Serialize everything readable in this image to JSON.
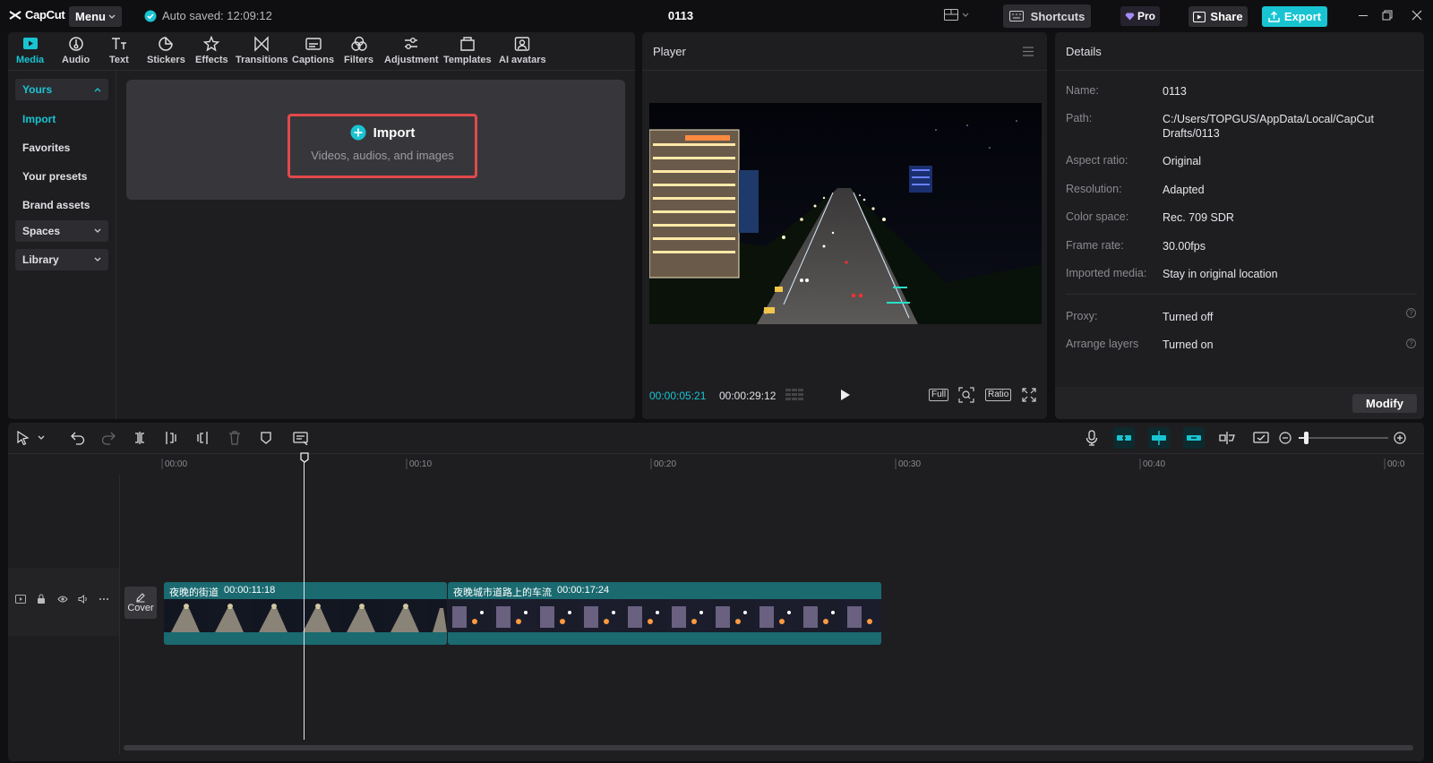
{
  "app": {
    "logo_text": "CapCut",
    "menu_label": "Menu",
    "autosave_text": "Auto saved: 12:09:12",
    "project_title": "0113",
    "shortcuts_label": "Shortcuts",
    "pro_label": "Pro",
    "share_label": "Share",
    "export_label": "Export"
  },
  "colors": {
    "accent": "#19c4d2",
    "highlight_border": "#e2494b",
    "clip_bg": "#1a6a70"
  },
  "tool_tabs": [
    {
      "label": "Media",
      "icon": "media-icon"
    },
    {
      "label": "Audio",
      "icon": "audio-icon"
    },
    {
      "label": "Text",
      "icon": "text-icon"
    },
    {
      "label": "Stickers",
      "icon": "stickers-icon"
    },
    {
      "label": "Effects",
      "icon": "effects-icon"
    },
    {
      "label": "Transitions",
      "icon": "transitions-icon"
    },
    {
      "label": "Captions",
      "icon": "captions-icon"
    },
    {
      "label": "Filters",
      "icon": "filters-icon"
    },
    {
      "label": "Adjustment",
      "icon": "adjustment-icon"
    },
    {
      "label": "Templates",
      "icon": "templates-icon"
    },
    {
      "label": "AI avatars",
      "icon": "ai-avatars-icon"
    }
  ],
  "sidebar": {
    "yours": "Yours",
    "items": [
      "Import",
      "Favorites",
      "Your presets",
      "Brand assets"
    ],
    "spaces": "Spaces",
    "library": "Library"
  },
  "import": {
    "title": "Import",
    "subtitle": "Videos, audios, and images"
  },
  "player": {
    "title": "Player",
    "current_time": "00:00:05:21",
    "total_time": "00:00:29:12",
    "full_label": "Full",
    "ratio_label": "Ratio"
  },
  "details": {
    "title": "Details",
    "rows": [
      {
        "label": "Name:",
        "value": "0113"
      },
      {
        "label": "Path:",
        "value": "C:/Users/TOPGUS/AppData/Local/CapCut Drafts/0113"
      },
      {
        "label": "Aspect ratio:",
        "value": "Original"
      },
      {
        "label": "Resolution:",
        "value": "Adapted"
      },
      {
        "label": "Color space:",
        "value": "Rec. 709 SDR"
      },
      {
        "label": "Frame rate:",
        "value": "30.00fps"
      },
      {
        "label": "Imported media:",
        "value": "Stay in original location"
      }
    ],
    "proxy_label": "Proxy:",
    "proxy_value": "Turned off",
    "arrange_label": "Arrange layers",
    "arrange_value": "Turned on",
    "modify_label": "Modify"
  },
  "timeline": {
    "ticks": [
      "00:00",
      "00:10",
      "00:20",
      "00:30",
      "00:40",
      "00:0"
    ],
    "cover_label": "Cover",
    "clips": [
      {
        "name": "夜晚的街道",
        "duration": "00:00:11:18"
      },
      {
        "name": "夜晚城市道路上的车流",
        "duration": "00:00:17:24"
      }
    ]
  }
}
